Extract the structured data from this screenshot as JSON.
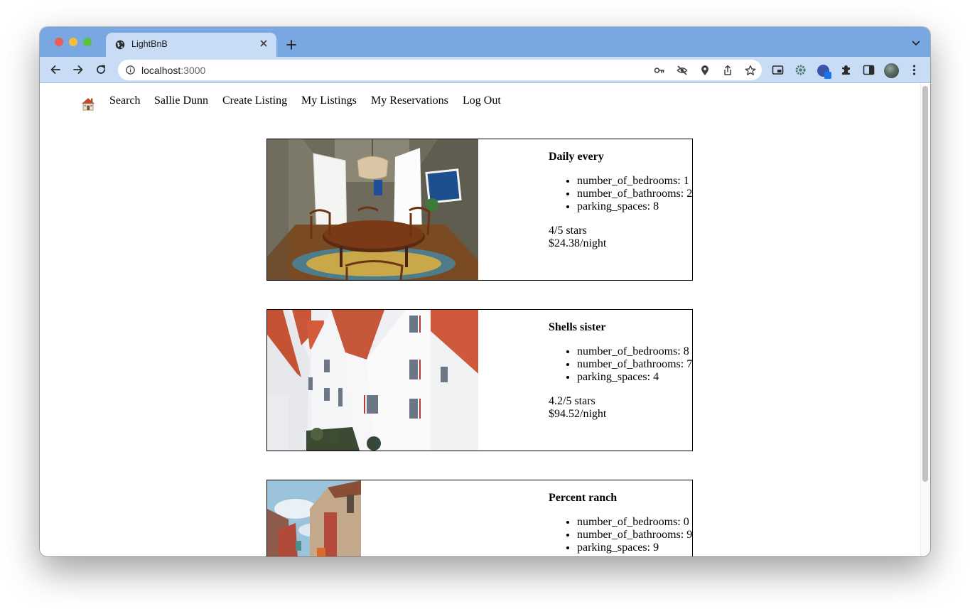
{
  "browser": {
    "tab_title": "LightBnB",
    "url_host": "localhost",
    "url_port": ":3000"
  },
  "nav": {
    "home_icon": "house-icon",
    "items": [
      "Search",
      "Sallie Dunn",
      "Create Listing",
      "My Listings",
      "My Reservations",
      "Log Out"
    ]
  },
  "listings": [
    {
      "title": "Daily every",
      "bedrooms": "number_of_bedrooms: 1",
      "bathrooms": "number_of_bathrooms: 2",
      "parking": "parking_spaces: 8",
      "rating": "4/5 stars",
      "price": "$24.38/night"
    },
    {
      "title": "Shells sister",
      "bedrooms": "number_of_bedrooms: 8",
      "bathrooms": "number_of_bathrooms: 7",
      "parking": "parking_spaces: 4",
      "rating": "4.2/5 stars",
      "price": "$94.52/night"
    },
    {
      "title": "Percent ranch",
      "bedrooms": "number_of_bedrooms: 0",
      "bathrooms": "number_of_bathrooms: 9",
      "parking": "parking_spaces: 9"
    }
  ],
  "colors": {
    "tabbar": "#79a7e1",
    "toolbar": "#c8dcf5",
    "card_border": "#000000"
  }
}
